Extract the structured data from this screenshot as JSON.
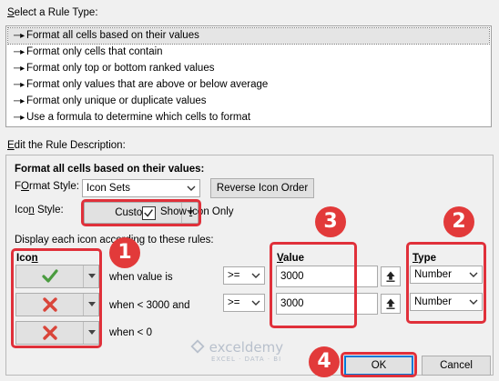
{
  "select_rule_type": {
    "title": "Select a Rule Type:",
    "title_underline_char": "S",
    "items": [
      {
        "label": "Format all cells based on their values",
        "selected": true
      },
      {
        "label": "Format only cells that contain",
        "selected": false
      },
      {
        "label": "Format only top or bottom ranked values",
        "selected": false
      },
      {
        "label": "Format only values that are above or below average",
        "selected": false
      },
      {
        "label": "Format only unique or duplicate values",
        "selected": false
      },
      {
        "label": "Use a formula to determine which cells to format",
        "selected": false
      }
    ]
  },
  "rule_description": {
    "title_u": "E",
    "title_rest": "dit the Rule Description:",
    "section_title": "Format all cells based on their values:",
    "format_style_label_u": "O",
    "format_style_label_pre": "F",
    "format_style_label_post": "rmat Style:",
    "format_style_value": "Icon Sets",
    "reverse_button": "Reverse Icon Order",
    "reverse_u": "d",
    "icon_style_label_pre": "Ico",
    "icon_style_label_u": "n",
    "icon_style_label_post": " Style:",
    "icon_style_value": "Custom",
    "show_icon_only_pre": "Show ",
    "show_icon_only_u": "I",
    "show_icon_only_post": "con Only",
    "show_icon_only_checked": true,
    "display_rules_label": "Display each icon according to these rules:",
    "col_icon_pre": "Ico",
    "col_icon_u": "n",
    "col_value": "Value",
    "col_value_u": "V",
    "col_type": "Type",
    "col_type_u": "T",
    "rows": [
      {
        "icon": "green-check",
        "text": "when value is",
        "operator": ">=",
        "value": "3000",
        "type": "Number"
      },
      {
        "icon": "red-x",
        "text": "when < 3000 and",
        "operator": ">=",
        "value": "3000",
        "type": "Number"
      },
      {
        "icon": "red-x",
        "text": "when < 0"
      }
    ]
  },
  "buttons": {
    "ok": "OK",
    "cancel": "Cancel"
  },
  "callouts": [
    "1",
    "2",
    "3",
    "4"
  ],
  "watermark": {
    "name": "exceldemy",
    "tagline": "EXCEL · DATA · BI"
  },
  "colors": {
    "callout_red": "#e0303a",
    "check_green": "#4a9b3f",
    "x_red": "#d9453a"
  }
}
